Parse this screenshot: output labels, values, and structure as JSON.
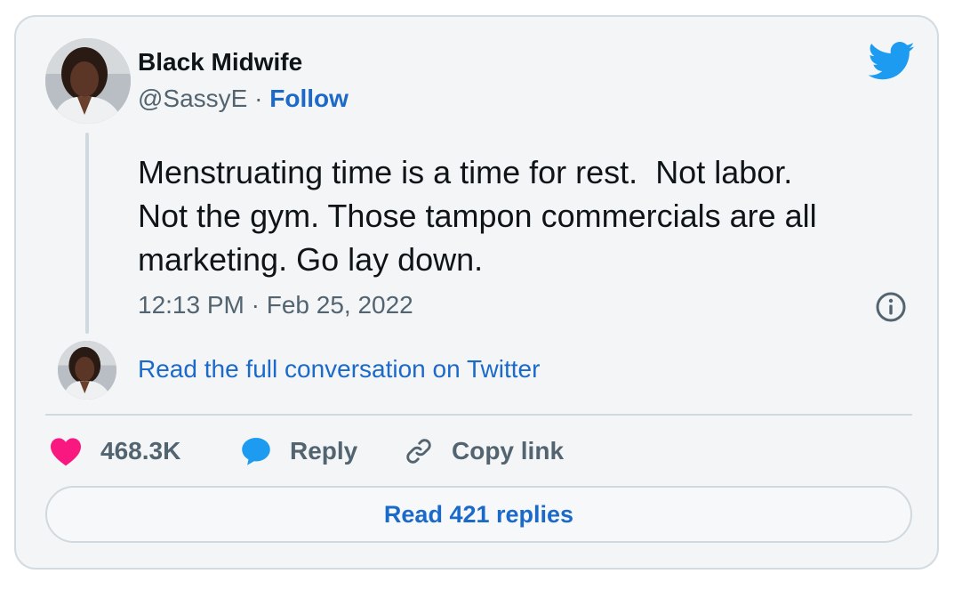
{
  "tweet": {
    "author_name": "Black Midwife",
    "handle": "@SassyE",
    "separator": " · ",
    "follow_label": "Follow",
    "text": "Menstruating time is a time for rest.  Not labor.\nNot the gym. Those tampon commercials are all\nmarketing. Go lay down.",
    "timestamp": "12:13 PM · Feb 25, 2022",
    "read_conversation_label": "Read the full conversation on Twitter",
    "actions": {
      "like_count": "468.3K",
      "reply_label": "Reply",
      "copy_link_label": "Copy link"
    },
    "read_replies_label": "Read 421 replies"
  },
  "icons": {
    "brand": "twitter-bird-icon",
    "info": "info-icon",
    "like": "heart-icon",
    "reply": "speech-bubble-icon",
    "copy": "link-icon"
  },
  "colors": {
    "link": "#1b6ac9",
    "twitter_blue": "#1d9bf0",
    "like_pink": "#f91880",
    "muted_text": "#536471",
    "primary_text": "#0f1419",
    "card_border": "#d3dbe2",
    "card_background": "#f4f5f6"
  }
}
